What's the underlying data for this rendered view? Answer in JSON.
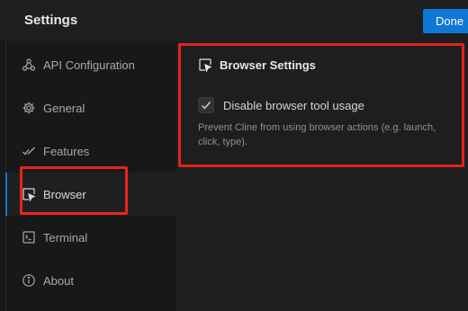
{
  "header": {
    "title": "Settings",
    "done_label": "Done"
  },
  "sidebar": {
    "items": [
      {
        "label": "API Configuration",
        "icon": "plug-icon"
      },
      {
        "label": "General",
        "icon": "gear-icon"
      },
      {
        "label": "Features",
        "icon": "check-icon"
      },
      {
        "label": "Browser",
        "icon": "cursor-window-icon",
        "active": true
      },
      {
        "label": "Terminal",
        "icon": "terminal-icon"
      },
      {
        "label": "About",
        "icon": "info-icon"
      }
    ]
  },
  "browser_settings": {
    "title": "Browser Settings",
    "checkbox_label": "Disable browser tool usage",
    "checkbox_checked": true,
    "description": "Prevent Cline from using browser actions (e.g. launch, click, type)."
  },
  "colors": {
    "accent": "#0e78d4",
    "highlight": "#e8231c",
    "background": "#1e1e1e",
    "sidebar": "#181818"
  }
}
